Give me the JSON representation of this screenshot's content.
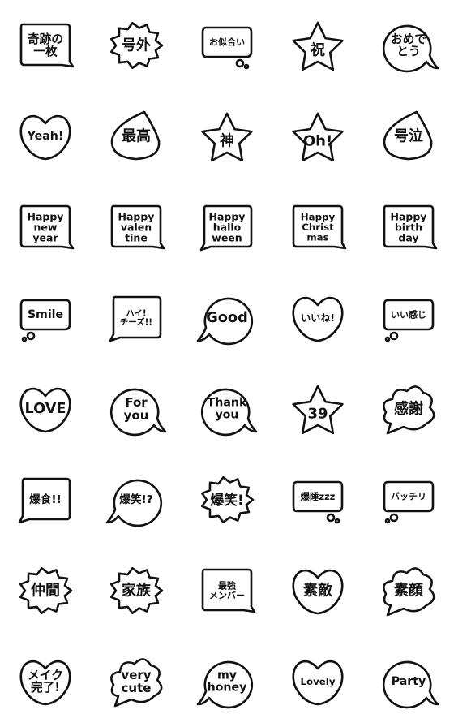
{
  "colors": {
    "stroke": "#111111",
    "background": "#ffffff"
  },
  "stickers": [
    {
      "shape": "rect-tail-right",
      "lines": [
        "奇跡の",
        "一枚"
      ]
    },
    {
      "shape": "burst",
      "lines": [
        "号外"
      ]
    },
    {
      "shape": "thought-right",
      "lines": [
        "お似合い"
      ]
    },
    {
      "shape": "star",
      "lines": [
        "祝"
      ]
    },
    {
      "shape": "round-tail-right",
      "lines": [
        "おめで",
        "とう"
      ]
    },
    {
      "shape": "heart",
      "lines": [
        "Yeah!"
      ]
    },
    {
      "shape": "drop",
      "lines": [
        "最高"
      ]
    },
    {
      "shape": "star",
      "lines": [
        "神"
      ]
    },
    {
      "shape": "star",
      "lines": [
        "Oh!"
      ]
    },
    {
      "shape": "drop",
      "lines": [
        "号泣"
      ]
    },
    {
      "shape": "rect-tail-right",
      "lines": [
        "Happy",
        "new",
        "year"
      ]
    },
    {
      "shape": "rect-tail-right",
      "lines": [
        "Happy",
        "valen",
        "tine"
      ]
    },
    {
      "shape": "rect-tail-left",
      "lines": [
        "Happy",
        "hallo",
        "ween"
      ]
    },
    {
      "shape": "rect-tail-right",
      "lines": [
        "Happy",
        "Christ",
        "mas"
      ]
    },
    {
      "shape": "rect-tail-right",
      "lines": [
        "Happy",
        "birth",
        "day"
      ]
    },
    {
      "shape": "thought-left",
      "lines": [
        "Smile"
      ]
    },
    {
      "shape": "rect-tail-left",
      "lines": [
        "ハイ!",
        "チーズ!!"
      ]
    },
    {
      "shape": "round-tail-left",
      "lines": [
        "Good"
      ]
    },
    {
      "shape": "heart",
      "lines": [
        "いいね!"
      ]
    },
    {
      "shape": "thought-left",
      "lines": [
        "いい感じ"
      ]
    },
    {
      "shape": "heart",
      "lines": [
        "LOVE"
      ]
    },
    {
      "shape": "round-tail-right",
      "lines": [
        "For",
        "you"
      ]
    },
    {
      "shape": "round-tail-right",
      "lines": [
        "Thank",
        "you"
      ]
    },
    {
      "shape": "star",
      "lines": [
        "39"
      ]
    },
    {
      "shape": "cloud",
      "lines": [
        "感謝"
      ]
    },
    {
      "shape": "rect-tail-left",
      "lines": [
        "爆食!!"
      ]
    },
    {
      "shape": "round-tail-left",
      "lines": [
        "爆笑!?"
      ]
    },
    {
      "shape": "burst",
      "lines": [
        "爆笑!"
      ]
    },
    {
      "shape": "thought-right",
      "lines": [
        "爆睡zzz"
      ]
    },
    {
      "shape": "thought-left",
      "lines": [
        "バッチリ"
      ]
    },
    {
      "shape": "burst",
      "lines": [
        "仲間"
      ]
    },
    {
      "shape": "burst",
      "lines": [
        "家族"
      ]
    },
    {
      "shape": "rect-tail-right",
      "lines": [
        "最強",
        "メンバー"
      ]
    },
    {
      "shape": "heart",
      "lines": [
        "素敵"
      ]
    },
    {
      "shape": "cloud",
      "lines": [
        "素顔"
      ]
    },
    {
      "shape": "heart",
      "lines": [
        "メイク",
        "完了!"
      ]
    },
    {
      "shape": "cloud",
      "lines": [
        "very",
        "cute"
      ]
    },
    {
      "shape": "round-tail-left",
      "lines": [
        "my",
        "honey"
      ]
    },
    {
      "shape": "heart",
      "lines": [
        "Lovely"
      ]
    },
    {
      "shape": "round-tail-right",
      "lines": [
        "Party"
      ]
    }
  ]
}
